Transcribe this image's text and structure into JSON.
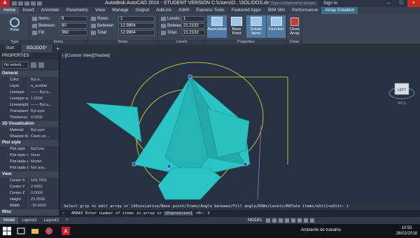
{
  "window": {
    "app_logo": "A",
    "title": "Autodesk AutoCAD 2016 - STUDENT VERSION    C:\\Users\\D...\\SOLIDOS.dwg",
    "search_placeholder": "Type a keyword or phrase",
    "sign_in": "Sign In"
  },
  "ribbon_tabs": [
    {
      "label": "Home"
    },
    {
      "label": "Insert"
    },
    {
      "label": "Annotate"
    },
    {
      "label": "Parametric"
    },
    {
      "label": "View"
    },
    {
      "label": "Manage"
    },
    {
      "label": "Output"
    },
    {
      "label": "Add-ins"
    },
    {
      "label": "A360"
    },
    {
      "label": "Express Tools"
    },
    {
      "label": "Featured Apps"
    },
    {
      "label": "BIM 360"
    },
    {
      "label": "Performance"
    },
    {
      "label": "Array Creation"
    }
  ],
  "ribbon": {
    "type_panel": {
      "button": "Polar",
      "title": "Type"
    },
    "items_panel": {
      "title": "Items",
      "fields": [
        {
          "label": "Items:",
          "value": "6"
        },
        {
          "label": "Between:",
          "value": "60"
        },
        {
          "label": "Fill:",
          "value": "360"
        }
      ]
    },
    "rows_panel": {
      "title": "Rows",
      "fields": [
        {
          "label": "Rows:",
          "value": "1"
        },
        {
          "label": "Between:",
          "value": "12.9904"
        },
        {
          "label": "Total:",
          "value": "12.9904"
        }
      ]
    },
    "levels_panel": {
      "title": "Levels",
      "fields": [
        {
          "label": "Levels:",
          "value": "1"
        },
        {
          "label": "Between:",
          "value": "21.2132"
        },
        {
          "label": "Total:",
          "value": "21.2132"
        }
      ]
    },
    "properties_panel": {
      "title": "Properties",
      "buttons": [
        {
          "label": "Associative"
        },
        {
          "label": "Base Point"
        },
        {
          "label": "Rotate Items"
        },
        {
          "label": "Direction"
        }
      ]
    },
    "close_panel": {
      "button": "Close Array",
      "title": "Close"
    }
  },
  "doc_tabs": [
    {
      "label": "Start"
    },
    {
      "label": "SOLIDOS*"
    }
  ],
  "properties": {
    "header": "PROPERTIES",
    "selection": "No selecti...",
    "sections": [
      {
        "title": "General",
        "rows": [
          {
            "k": "Color",
            "v": "ByLa..."
          },
          {
            "k": "Layer",
            "v": "a_auxiliar"
          },
          {
            "k": "Linetype",
            "v": "—— ByLa..."
          },
          {
            "k": "Linetype sc...",
            "v": "1.0000"
          },
          {
            "k": "Lineweight",
            "v": "—— ByLa..."
          },
          {
            "k": "Transparency",
            "v": "ByLayer"
          },
          {
            "k": "Thickness",
            "v": "0.0000"
          }
        ]
      },
      {
        "title": "3D Visualization",
        "rows": [
          {
            "k": "Material",
            "v": "ByLayer"
          },
          {
            "k": "Shadow dis...",
            "v": "Casts an..."
          }
        ]
      },
      {
        "title": "Plot style",
        "rows": [
          {
            "k": "Plot style",
            "v": "ByColor"
          },
          {
            "k": "Plot style t...",
            "v": "None"
          },
          {
            "k": "Plot table a...",
            "v": "Model"
          },
          {
            "k": "Plot table t...",
            "v": "Not ava..."
          }
        ]
      },
      {
        "title": "View",
        "rows": [
          {
            "k": "Center X",
            "v": "104.7652"
          },
          {
            "k": "Center Y",
            "v": "2.4952"
          },
          {
            "k": "Center Z",
            "v": "0.0000"
          },
          {
            "k": "Height",
            "v": "23.3539"
          },
          {
            "k": "Width",
            "v": "-15.6030"
          }
        ]
      },
      {
        "title": "Misc",
        "rows": []
      }
    ]
  },
  "viewport": {
    "label": "[-][Custom View][Shaded]",
    "viewcube_face": "LEFT",
    "viewcube_compass": "WCS"
  },
  "command": {
    "history": "Select grip to edit array or [ASsociative/Base point/Items/Angle between/Fill angle/ROWs/Levels/ROTate items/eXit]<eXit>: i",
    "prompt_prefix": "ARRAY Enter number of items in array or ",
    "prompt_option": "[Expression]",
    "prompt_suffix": " <6>: 3",
    "close_glyph": "×"
  },
  "status_tabs": [
    {
      "label": "Model"
    },
    {
      "label": "Layout1"
    },
    {
      "label": "Layout2"
    }
  ],
  "status": {
    "model": "MODEL"
  },
  "taskbar": {
    "tray_label": "Ambiente de trabalho",
    "time": "10:55",
    "date": "26/02/2018"
  },
  "colors": {
    "solid_fill": "#2bc4c4",
    "wire_yellow": "#e2e23a",
    "accent_blue": "#4f7ba5"
  }
}
